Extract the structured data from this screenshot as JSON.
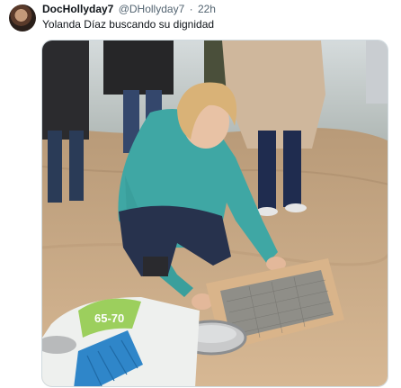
{
  "author": {
    "display_name": "DocHollyday7",
    "handle": "@DHollyday7",
    "separator": "·",
    "time": "22h"
  },
  "tweet_text": "Yolanda Díaz buscando su dignidad",
  "media": {
    "bag_label": "65-70",
    "colors": {
      "sand": "#c9a57c",
      "sea": "#b9c3c6",
      "sweater": "#3fa7a4",
      "jeans": "#27324d",
      "sieve_frame": "#d9b48a"
    }
  }
}
